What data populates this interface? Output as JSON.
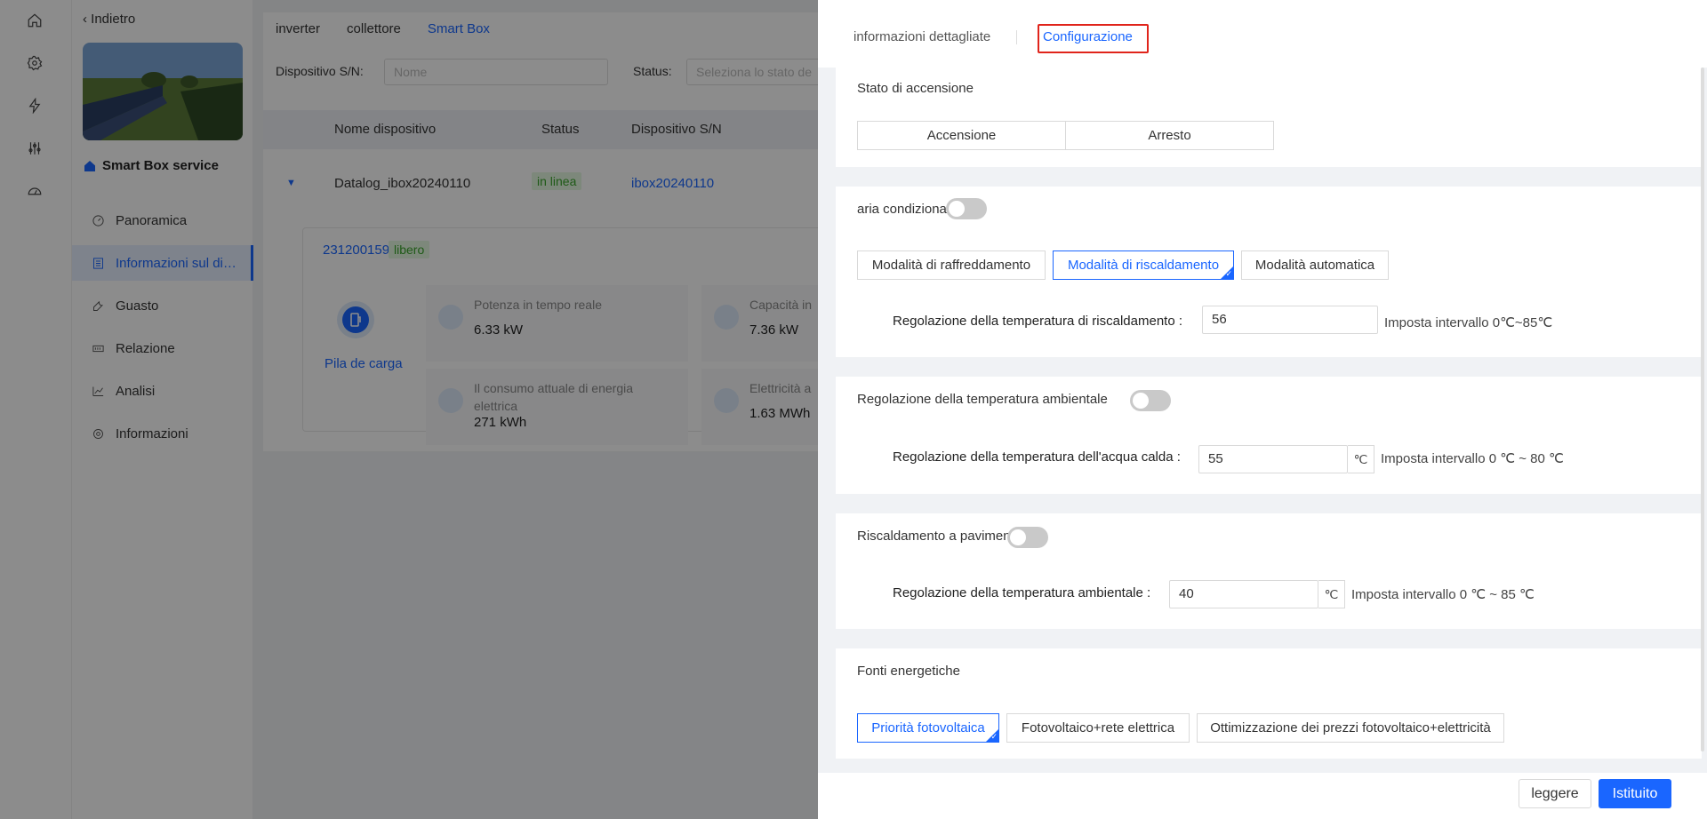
{
  "app": {
    "back_label": "Indietro",
    "service_name": "Smart Box service",
    "nav": [
      {
        "label": "Panoramica"
      },
      {
        "label": "Informazioni sul di…"
      },
      {
        "label": "Guasto"
      },
      {
        "label": "Relazione"
      },
      {
        "label": "Analisi"
      },
      {
        "label": "Informazioni"
      }
    ],
    "tabs": [
      "inverter",
      "collettore",
      "Smart Box"
    ],
    "filter": {
      "sn_label": "Dispositivo S/N:",
      "sn_placeholder": "Nome",
      "status_label": "Status:",
      "status_placeholder": "Seleziona lo stato de"
    },
    "table": {
      "headers": [
        "Nome dispositivo",
        "Status",
        "Dispositivo S/N"
      ],
      "row": {
        "name": "Datalog_ibox20240110",
        "status": "in linea",
        "sn": "ibox20240110"
      }
    },
    "sub": {
      "id": "231200159",
      "tag": "libero",
      "device_label": "Pila de carga",
      "metrics": [
        {
          "label": "Potenza in tempo reale",
          "value": "6.33 kW"
        },
        {
          "label": "Capacità in",
          "value": "7.36 kW"
        },
        {
          "label": "Il consumo attuale di energia elettrica",
          "value": "271 kWh"
        },
        {
          "label": "Elettricità a",
          "value": "1.63 MWh"
        }
      ]
    }
  },
  "drawer": {
    "tabs": {
      "details": "informazioni dettagliate",
      "config": "Configurazione"
    },
    "power": {
      "title": "Stato di accensione",
      "on": "Accensione",
      "off": "Arresto"
    },
    "ac": {
      "title": "aria condizionata",
      "enabled": false,
      "modes": [
        "Modalità di raffreddamento",
        "Modalità di riscaldamento",
        "Modalità automatica"
      ],
      "selected_mode": "Modalità di riscaldamento",
      "field_label": "Regolazione della temperatura di riscaldamento :",
      "field_value": "56",
      "hint": "Imposta intervallo 0℃~85℃"
    },
    "room": {
      "title": "Regolazione della temperatura ambientale",
      "enabled": false,
      "field_label": "Regolazione della temperatura dell'acqua calda :",
      "field_value": "55",
      "unit": "℃",
      "hint": "Imposta intervallo 0 ℃ ~ 80 ℃"
    },
    "floor": {
      "title": "Riscaldamento a pavimento",
      "enabled": false,
      "field_label": "Regolazione della temperatura ambientale :",
      "field_value": "40",
      "unit": "℃",
      "hint": "Imposta intervallo 0 ℃ ~ 85 ℃"
    },
    "energy": {
      "title": "Fonti energetiche",
      "options": [
        "Priorità fotovoltaica",
        "Fotovoltaico+rete elettrica",
        "Ottimizzazione dei prezzi fotovoltaico+elettricità"
      ],
      "selected": "Priorità fotovoltaica"
    },
    "footer": {
      "read": "leggere",
      "set": "Istituito"
    }
  },
  "colors": {
    "accent": "#1a66ff",
    "highlight_box": "#e0241b",
    "online": "#3aa52b"
  }
}
